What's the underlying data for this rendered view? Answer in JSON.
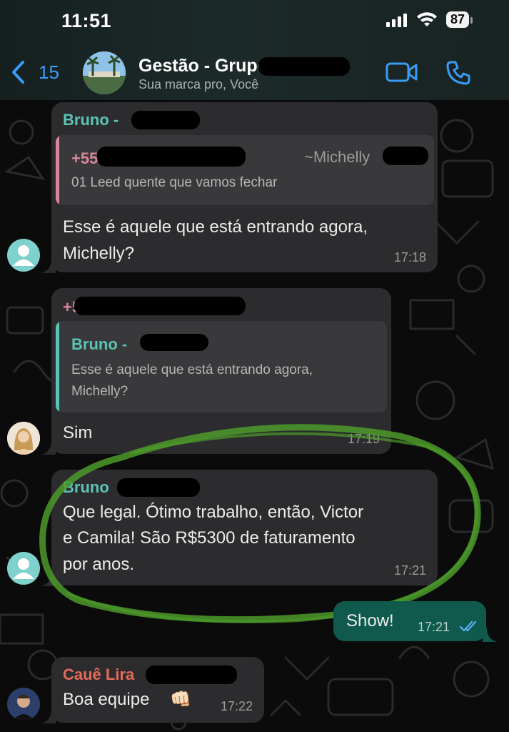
{
  "status_bar": {
    "time": "11:51",
    "battery": "87"
  },
  "header": {
    "back_count": "15",
    "title": "Gestão - Grupo",
    "subtitle": "Sua marca pro, Você"
  },
  "messages": [
    {
      "sender": "Bruno -",
      "quote_sender": "+55",
      "quote_author": "~Michelly",
      "quote_text": "01 Leed quente que vamos fechar",
      "text_line1": "Esse é aquele que está entrando agora,",
      "text_line2": "Michelly?",
      "time": "17:18"
    },
    {
      "sender": "+55",
      "quote_sender": "Bruno -",
      "quote_text_line1": "Esse é aquele que está entrando agora,",
      "quote_text_line2": "Michelly?",
      "text": "Sim",
      "time": "17:19"
    },
    {
      "sender": "Bruno",
      "text_line1": "Que legal. Ótimo trabalho, então, Victor",
      "text_line2": "e Camila! São R$5300 de faturamento",
      "text_line3": "por anos.",
      "time": "17:21"
    },
    {
      "text": "Show!",
      "time": "17:21"
    },
    {
      "sender": "Cauê Lira",
      "text": "Boa equipe",
      "emoji": "👊🏻",
      "time": "17:22"
    }
  ],
  "colors": {
    "accent_blue": "#3a9bf4",
    "sender_teal": "#5cc3b5",
    "sender_pink": "#d9869a",
    "sender_red": "#e56a5a",
    "outgoing_bubble": "#0f5a4c",
    "incoming_bubble": "#2c2c2e",
    "annotation_green": "#4c9a2a"
  }
}
